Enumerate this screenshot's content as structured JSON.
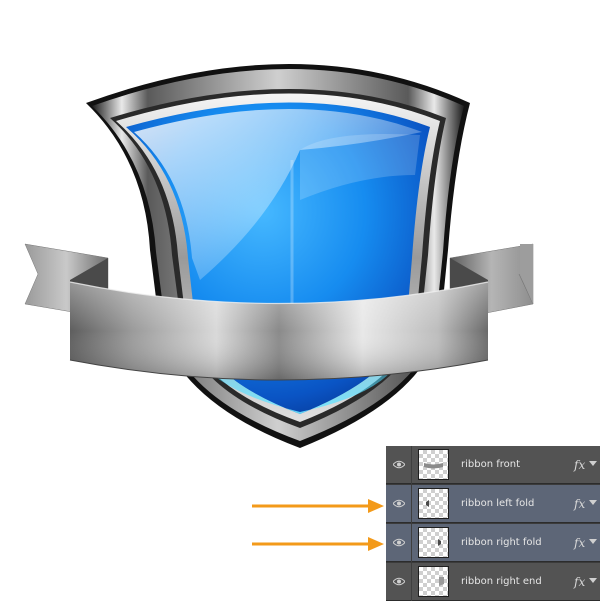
{
  "layers_panel": {
    "layers": [
      {
        "name": "ribbon front",
        "fx": "fx",
        "selected": false,
        "visibility_icon": "eye-icon"
      },
      {
        "name": "ribbon left fold",
        "fx": "fx",
        "selected": true,
        "visibility_icon": "eye-icon"
      },
      {
        "name": "ribbon right fold",
        "fx": "fx",
        "selected": true,
        "visibility_icon": "eye-icon"
      },
      {
        "name": "ribbon right end",
        "fx": "fx",
        "selected": false,
        "visibility_icon": "eye-icon"
      }
    ]
  },
  "colors": {
    "arrow": "#f39a1a",
    "shield_blue": "#1a8ff2",
    "panel_bg": "#535353",
    "panel_selected": "#5d6677"
  }
}
